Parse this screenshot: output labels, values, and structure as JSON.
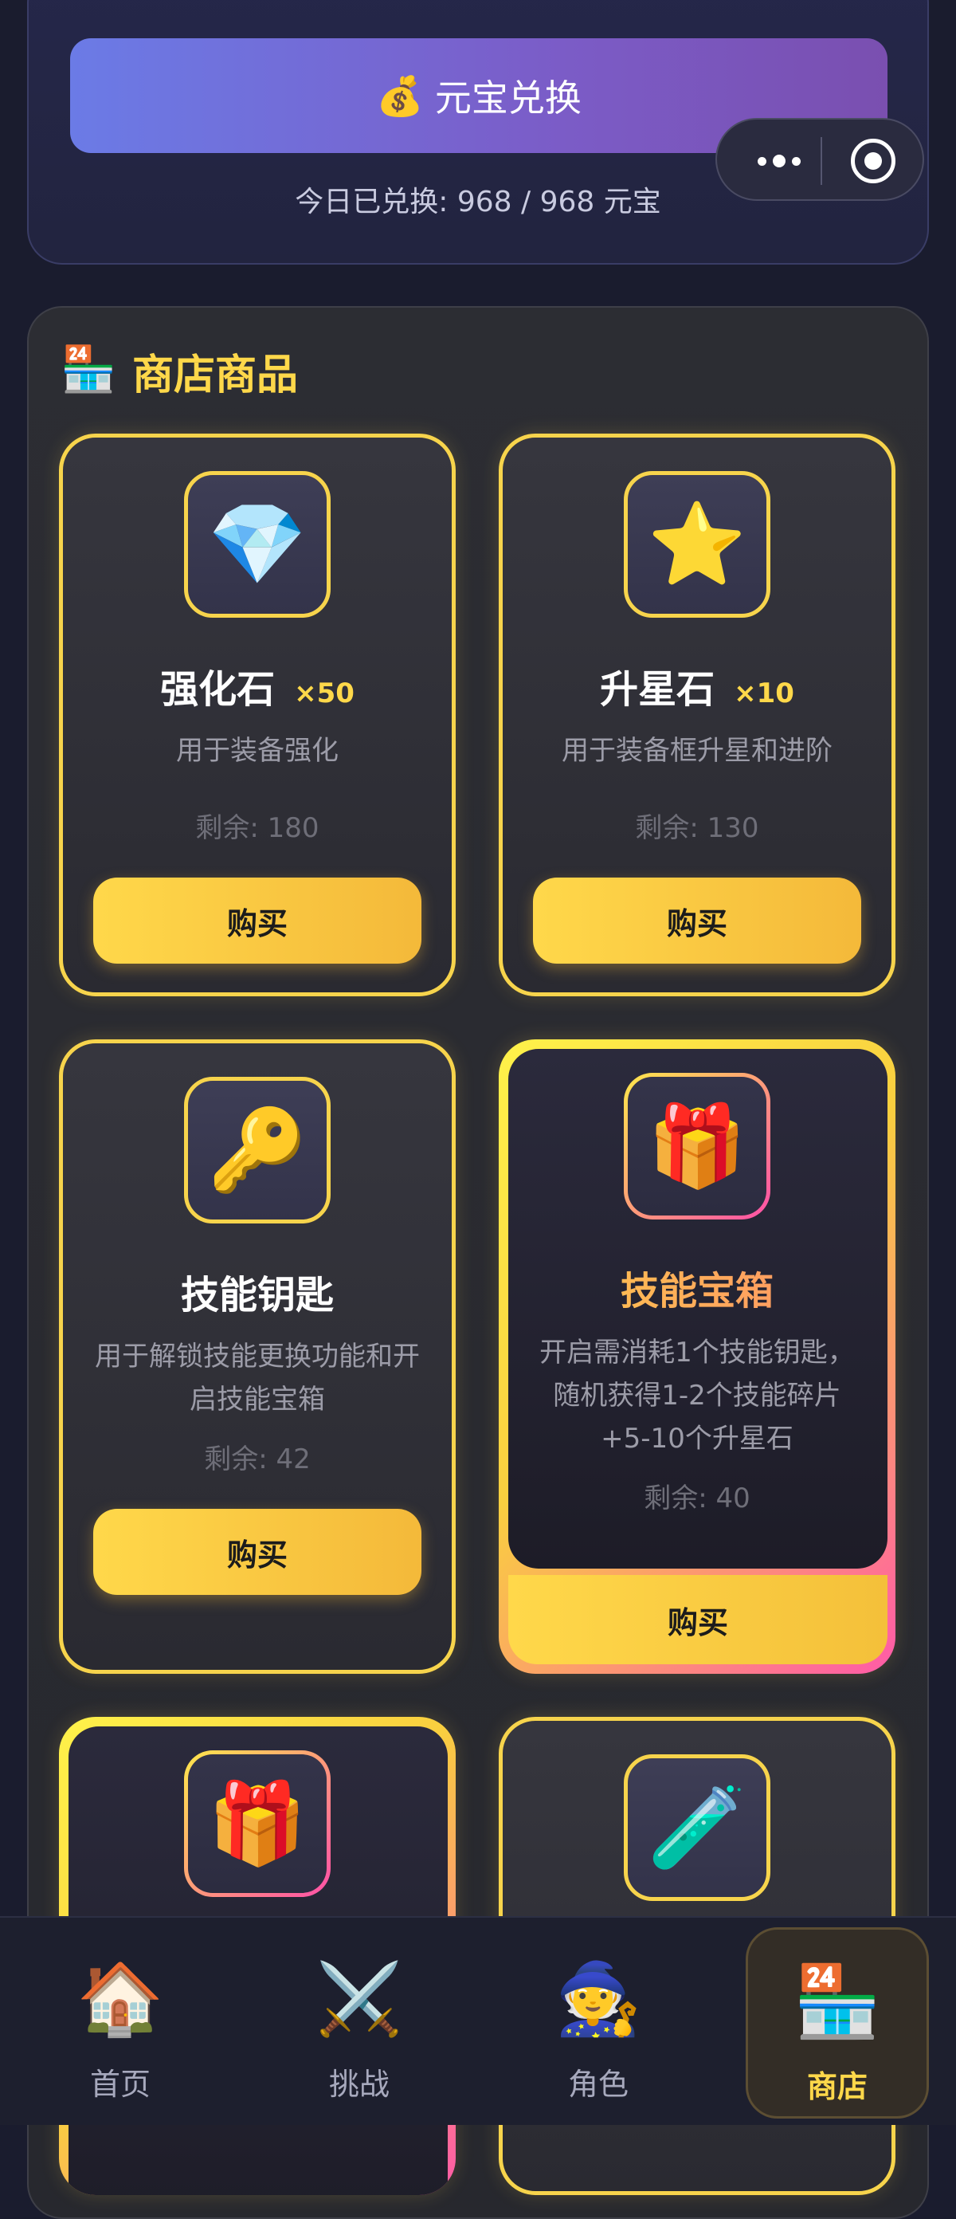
{
  "exchange": {
    "button_icon": "💰",
    "button_label": "元宝兑换",
    "info": "今日已兑换: 968 / 968 元宝"
  },
  "shop": {
    "title_icon": "🏪",
    "title": "商店商品",
    "items": [
      {
        "icon": "💎",
        "name": "强化石",
        "qty": "×50",
        "desc": "用于装备强化",
        "stock": "剩余: 180",
        "buy": "购买"
      },
      {
        "icon": "⭐",
        "name": "升星石",
        "qty": "×10",
        "desc": "用于装备框升星和进阶",
        "stock": "剩余: 130",
        "buy": "购买"
      },
      {
        "icon": "🔑",
        "name": "技能钥匙",
        "qty": "",
        "desc": "用于解锁技能更换功能和开启技能宝箱",
        "stock": "剩余: 42",
        "buy": "购买"
      },
      {
        "icon": "🎁",
        "name": "技能宝箱",
        "qty": "",
        "desc": "开启需消耗1个技能钥匙，随机获得1-2个技能碎片+5-10个升星石",
        "stock": "剩余: 40",
        "buy": "购买"
      },
      {
        "icon": "🎁"
      },
      {
        "icon": "🧪"
      }
    ]
  },
  "tabbar": {
    "tabs": [
      {
        "icon": "🏠",
        "label": "首页"
      },
      {
        "icon": "⚔️",
        "label": "挑战"
      },
      {
        "icon": "🧙",
        "label": "角色"
      },
      {
        "icon": "🏪",
        "label": "商店"
      }
    ],
    "active": "商店"
  },
  "colors": {
    "accent": "#ffd84a",
    "background": "#1a1c2e",
    "exchange_gradient_start": "#6b7be6",
    "exchange_gradient_end": "#7a4fb0",
    "special_border_pink": "#ff4fa8"
  }
}
